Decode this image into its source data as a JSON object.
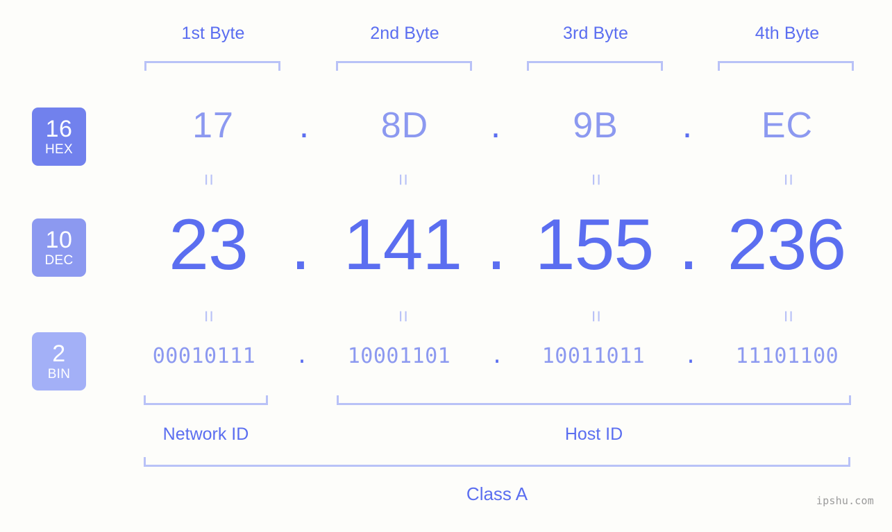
{
  "headers": {
    "bytes": [
      "1st Byte",
      "2nd Byte",
      "3rd Byte",
      "4th Byte"
    ]
  },
  "bases": [
    {
      "number": "16",
      "name": "HEX",
      "color": "#7181ed"
    },
    {
      "number": "10",
      "name": "DEC",
      "color": "#8c99f0"
    },
    {
      "number": "2",
      "name": "BIN",
      "color": "#a3b0f7"
    }
  ],
  "rows": {
    "hex": {
      "values": [
        "17",
        "8D",
        "9B",
        "EC"
      ],
      "separator": "."
    },
    "dec": {
      "values": [
        "23",
        "141",
        "155",
        "236"
      ],
      "separator": "."
    },
    "bin": {
      "values": [
        "00010111",
        "10001101",
        "10011011",
        "11101100"
      ],
      "separator": "."
    }
  },
  "equivalence_mark": "=",
  "sections": [
    {
      "label": "Network ID"
    },
    {
      "label": "Host ID"
    }
  ],
  "class": {
    "label": "Class A"
  },
  "watermark": {
    "text": "ipshu.com"
  },
  "colors": {
    "background": "#fdfdfa",
    "accent_strong": "#5b6ef0",
    "accent_mid": "#8c99f0",
    "accent_light": "#b9c2f7",
    "badge_hex": "#7181ed",
    "badge_dec": "#8c99f0",
    "badge_bin": "#a3b0f7",
    "watermark": "#9b9b9b"
  }
}
